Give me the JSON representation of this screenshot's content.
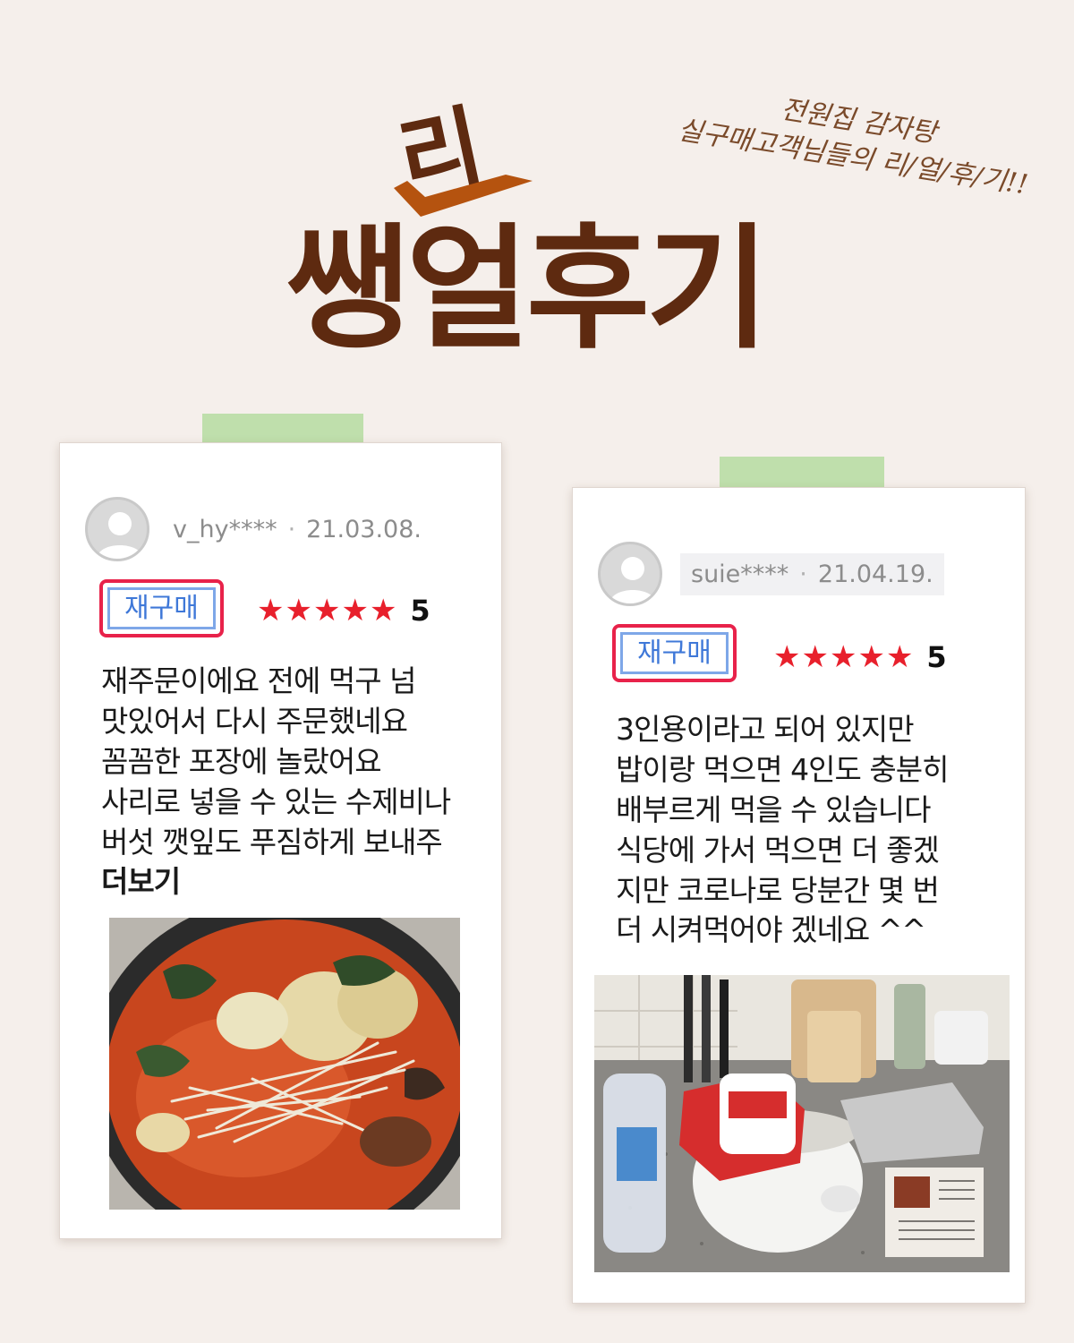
{
  "header": {
    "subtitle_line1": "전원집 감자탕",
    "subtitle_line2": "실구매고객님들의 리/얼/후/기!!",
    "title_accent": "리",
    "title_main": "쌩얼후기",
    "colors": {
      "title": "#5e2a10",
      "check": "#b5530f",
      "background": "#f5efeb"
    }
  },
  "reviews": [
    {
      "user": "v_hy****",
      "date": "21.03.08.",
      "badge": "재구매",
      "rating_stars": 5,
      "score": "5",
      "lines": [
        "재주문이에요 전에 먹구 넘",
        "맛있어서 다시 주문했네요",
        "꼼꼼한 포장에 놀랐어요",
        "사리로 넣을 수 있는 수제비나",
        "버섯 깻잎도 푸짐하게 보내주"
      ],
      "more": "더보기",
      "photo": "gamjatang-pot-photo"
    },
    {
      "user": "suie****",
      "date": "21.04.19.",
      "badge": "재구매",
      "rating_stars": 5,
      "score": "5",
      "lines": [
        "3인용이라고 되어 있지만",
        "밥이랑 먹으면 4인도 충분히",
        "배부르게 먹을 수 있습니다",
        "식당에 가서 먹으면 더 좋겠",
        "지만 코로나로 당분간 몇 번",
        "더 시켜먹어야 겠네요 ^^"
      ],
      "photo": "kitchen-package-photo"
    }
  ]
}
